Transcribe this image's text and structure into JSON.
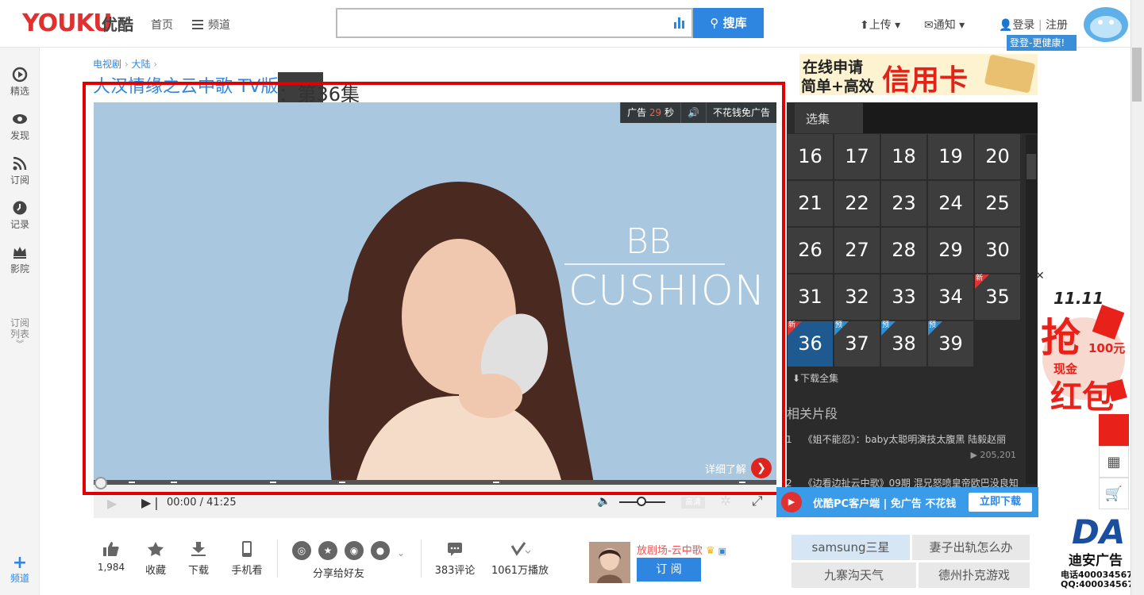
{
  "header": {
    "logo": "YOUKU",
    "logo_cn": "优酷",
    "nav_home": "首页",
    "nav_channel": "频道",
    "search_button": "搜库",
    "upload": "上传",
    "notify": "通知",
    "login": "登录",
    "register": "注册",
    "login_tip": "登登-更健康!"
  },
  "leftrail": {
    "items": [
      {
        "label": "精选"
      },
      {
        "label": "发现"
      },
      {
        "label": "订阅"
      },
      {
        "label": "记录"
      },
      {
        "label": "影院"
      }
    ],
    "sub_list": "订阅\n列表",
    "channel": "频道"
  },
  "breadcrumb": {
    "level1": "电视剧",
    "level2": "大陆"
  },
  "video": {
    "title": "大汉情缘之云中歌 TV版",
    "episode": "：第36集",
    "ad_label": "广告",
    "ad_countdown": "29",
    "ad_unit": "秒",
    "skip_ad": "不花钱免广告",
    "ad_text_line1": "BB",
    "ad_text_line2": "CUSHION",
    "detail": "详细了解",
    "time_current": "00:00",
    "time_total": "41:25",
    "quality": "高清"
  },
  "banner_ad": {
    "text1": "在线申请",
    "text2": "简单+高效",
    "text3": "信用卡"
  },
  "episodes": {
    "tab": "选集",
    "list": [
      {
        "n": "16"
      },
      {
        "n": "17"
      },
      {
        "n": "18"
      },
      {
        "n": "19"
      },
      {
        "n": "20"
      },
      {
        "n": "21"
      },
      {
        "n": "22"
      },
      {
        "n": "23"
      },
      {
        "n": "24"
      },
      {
        "n": "25"
      },
      {
        "n": "26"
      },
      {
        "n": "27"
      },
      {
        "n": "28"
      },
      {
        "n": "29"
      },
      {
        "n": "30"
      },
      {
        "n": "31"
      },
      {
        "n": "32"
      },
      {
        "n": "33"
      },
      {
        "n": "34"
      },
      {
        "n": "35",
        "tag": "新"
      },
      {
        "n": "36",
        "tag": "新",
        "active": true
      },
      {
        "n": "37",
        "tag": "预"
      },
      {
        "n": "38",
        "tag": "预"
      },
      {
        "n": "39",
        "tag": "预"
      }
    ],
    "download_all": "下载全集"
  },
  "related": {
    "heading": "相关片段",
    "items": [
      {
        "idx": "1",
        "title": "《姐不能忍》：baby太聪明演技太腹黑 陆毅赵丽",
        "plays": "205,201"
      },
      {
        "idx": "2",
        "title": "《边看边扯云中歌》09期 混兄怒喷皇帝欧巴没良知"
      }
    ]
  },
  "pc_ad": {
    "text": "优酷PC客户端 | 免广告 不花钱",
    "button": "立即下载"
  },
  "actions": {
    "like_count": "1,984",
    "favorite": "收藏",
    "download": "下载",
    "mobile": "手机看",
    "share": "分享给好友",
    "comments": "383评论",
    "plays": "1061万播放"
  },
  "uploader": {
    "name": "放剧场-云中歌",
    "subscribe": "订 阅"
  },
  "tags": [
    "samsung三星",
    "妻子出轨怎么办",
    "九寨沟天气",
    "德州扑克游戏"
  ],
  "promo": {
    "line1": "抢",
    "line2": "100元",
    "line3": "现金",
    "line4": "红包"
  },
  "da": {
    "brand": "DA",
    "name": "迪安广告",
    "phone": "电话4000345674",
    "qq": "QQ:4000345674"
  },
  "colors": {
    "brand_blue": "#2e86e0",
    "youku_red": "#e03030",
    "highlight": "#e00000"
  }
}
